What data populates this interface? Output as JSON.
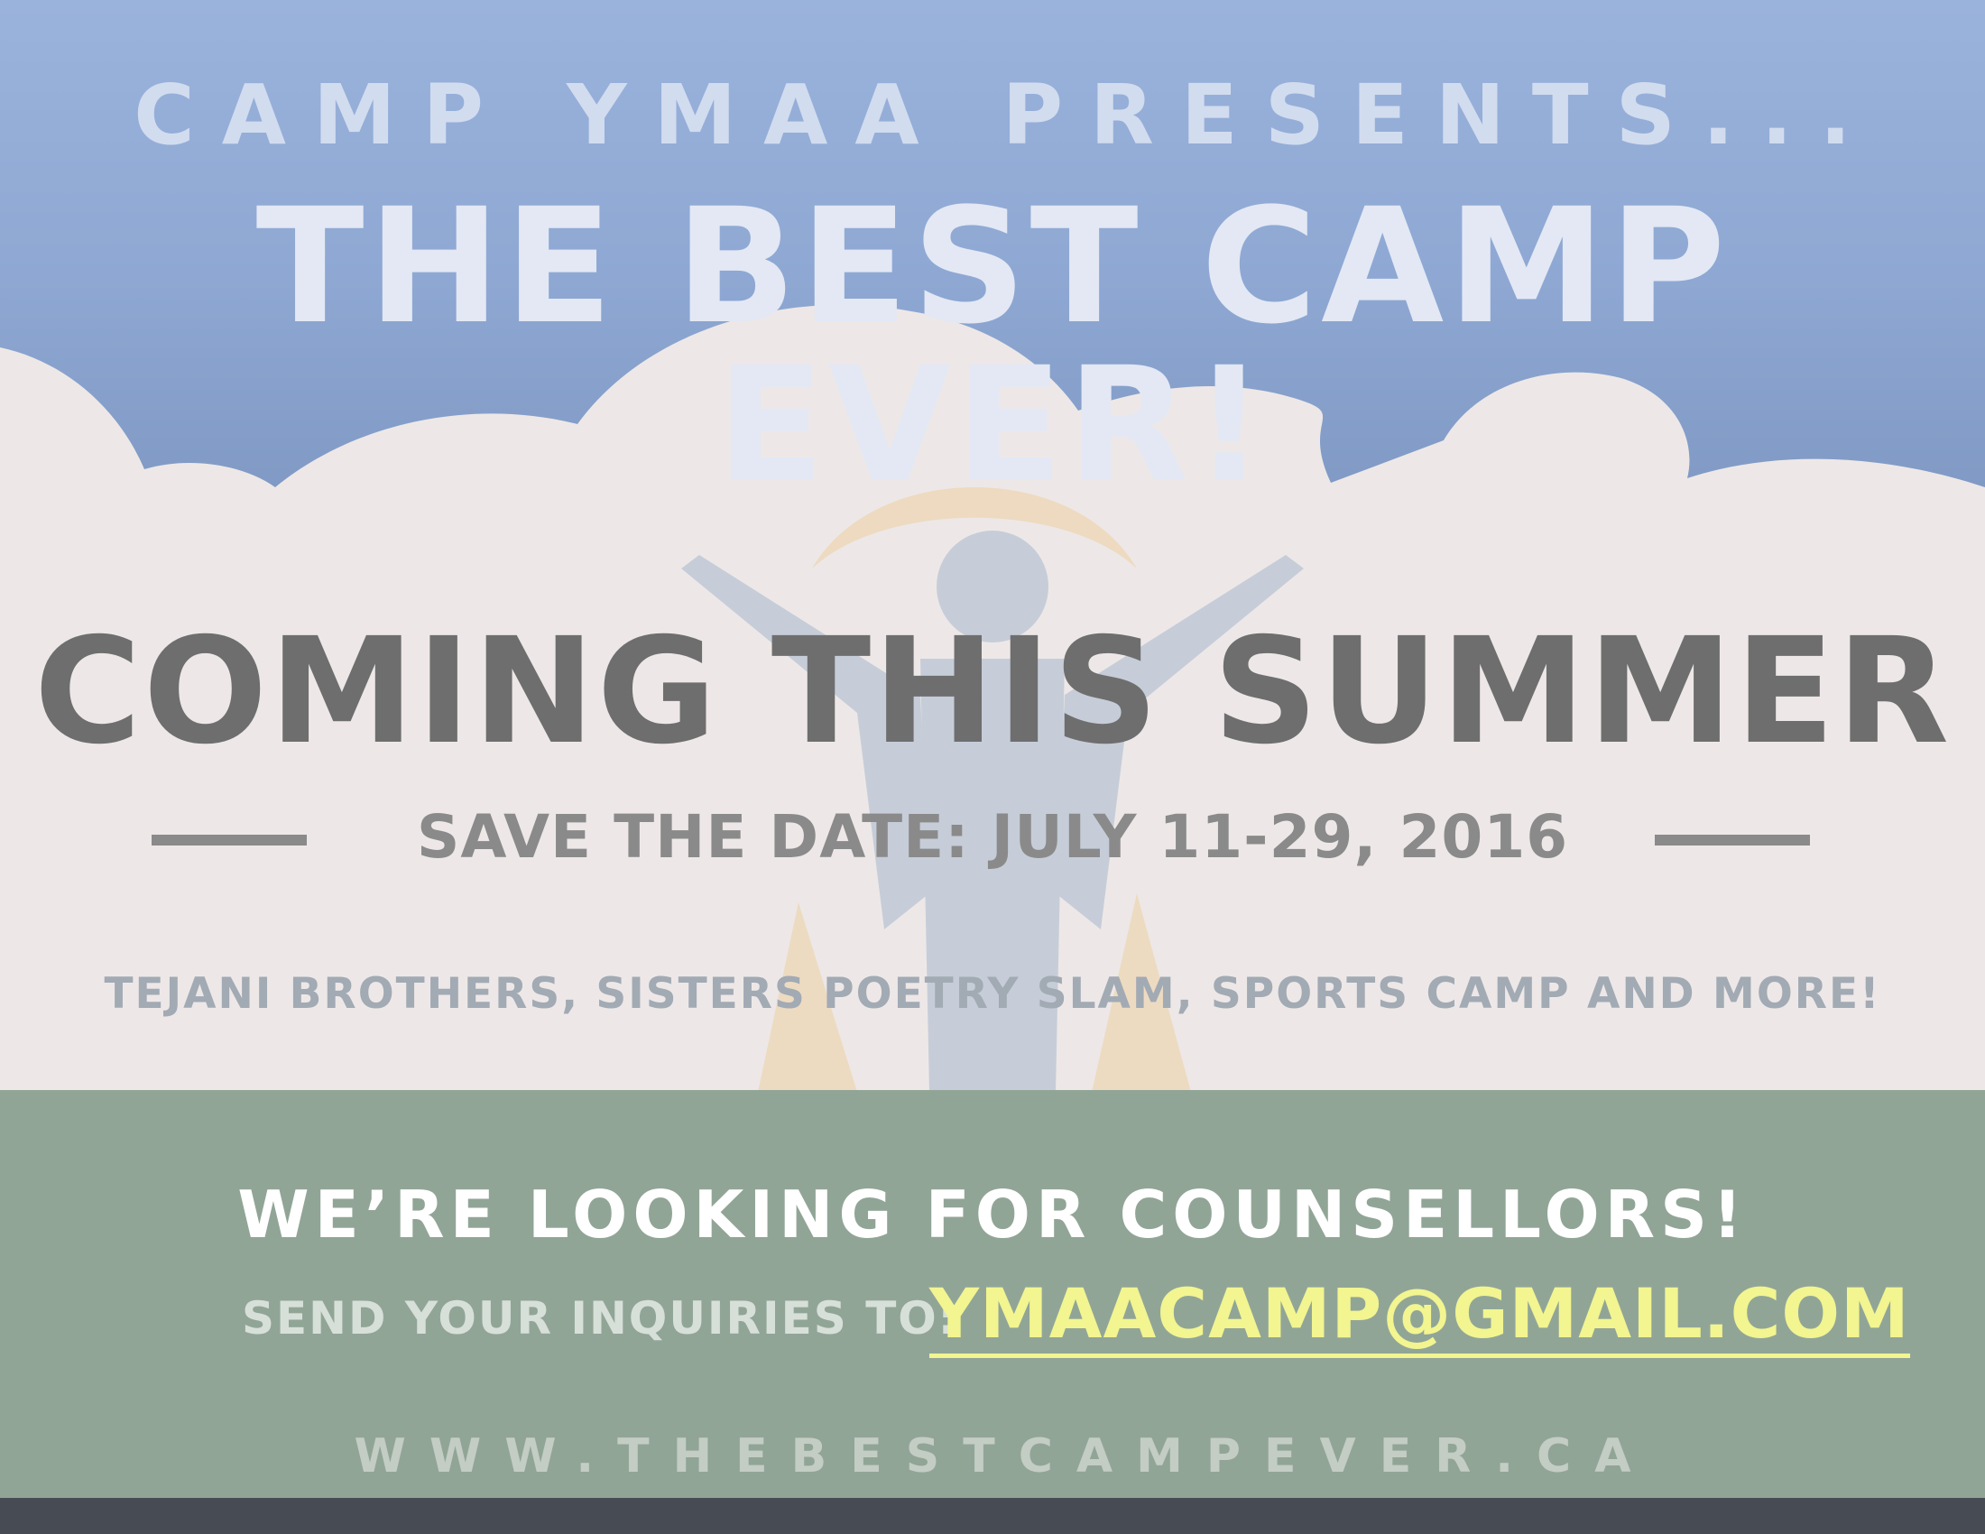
{
  "header": {
    "presents": "CAMP YMAA PRESENTS...",
    "title": "THE BEST CAMP EVER!"
  },
  "main": {
    "headline": "COMING THIS SUMMER",
    "save_date": "SAVE THE DATE: JULY 11-29, 2016",
    "lineup": "TEJANI BROTHERS, SISTERS POETRY SLAM, SPORTS CAMP AND MORE!"
  },
  "recruit": {
    "heading": "WE’RE LOOKING FOR COUNSELLORS!",
    "inquiry_label": "SEND YOUR INQUIRIES TO:",
    "email": "YMAACAMP@GMAIL.COM"
  },
  "footer": {
    "website": "WWW.THEBESTCAMPEVER.CA"
  },
  "colors": {
    "sky": "#8ea8d3",
    "cloud": "#ede8e7",
    "green_band": "#91a597",
    "footer_bar": "#474c54",
    "email_accent": "#f2f590",
    "watermark_figure": "#c6cdd8",
    "watermark_arc": "#ecd7b8"
  },
  "icons": [
    "cloud-shape",
    "camp-logo-watermark-icon"
  ]
}
